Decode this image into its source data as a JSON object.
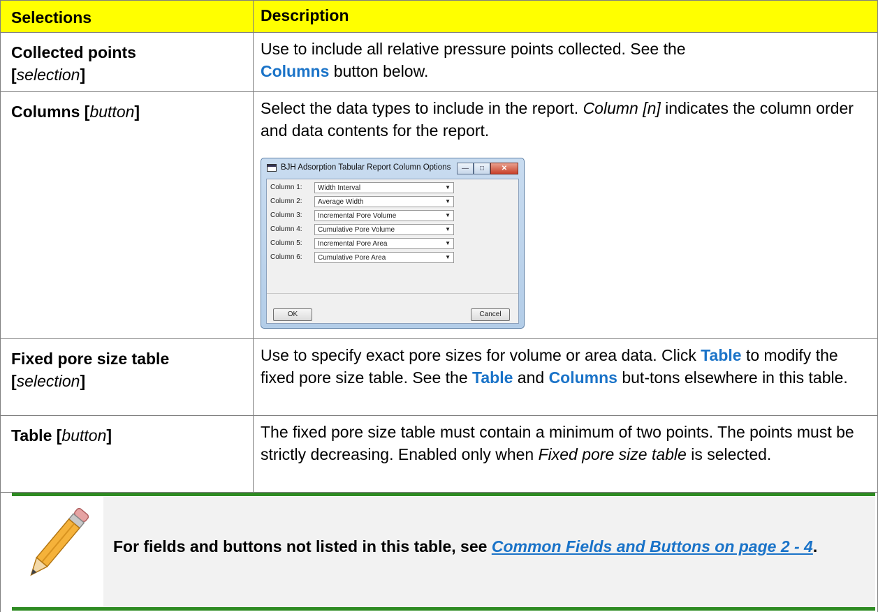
{
  "header": {
    "col1": "Selections",
    "col2": "Description"
  },
  "rows": [
    {
      "sel_name": "Collected points",
      "sel_bracket_open": "[",
      "sel_type": "selection",
      "sel_bracket_close": "]",
      "desc": {
        "p1": "Use to include all relative pressure points collected. See the",
        "link1": "Columns",
        "p2": " button below."
      }
    },
    {
      "sel_name": "Columns [",
      "sel_type": "button",
      "sel_bracket_close": "]",
      "desc": {
        "p1": "Select the data types to include in the report. ",
        "italic1": "Column [n]",
        "p2": " indicates the column order and data contents for the report."
      }
    },
    {
      "sel_name": "Fixed pore size table",
      "sel_bracket_open": "[",
      "sel_type": "selection",
      "sel_bracket_close": "]",
      "desc": {
        "p1": "Use to specify exact pore sizes for volume or area data. Click ",
        "link1": "Table",
        "p2": " to modify the fixed pore size table. See the ",
        "link2": "Table",
        "p3": " and ",
        "link3": "Columns",
        "p4": " but-tons elsewhere in this table."
      }
    },
    {
      "sel_name": "Table [",
      "sel_type": "button",
      "sel_bracket_close": "]",
      "desc": {
        "p1": "The fixed pore size table must contain a minimum of two points. The points must be strictly decreasing. Enabled only when ",
        "italic1": "Fixed pore size table",
        "p2": " is selected."
      }
    }
  ],
  "dialog": {
    "title": "BJH Adsorption Tabular Report Column Options",
    "columns": [
      {
        "label": "Column 1:",
        "value": "Width Interval"
      },
      {
        "label": "Column 2:",
        "value": "Average Width"
      },
      {
        "label": "Column 3:",
        "value": "Incremental Pore Volume"
      },
      {
        "label": "Column 4:",
        "value": "Cumulative Pore Volume"
      },
      {
        "label": "Column 5:",
        "value": "Incremental Pore Area"
      },
      {
        "label": "Column 6:",
        "value": "Cumulative Pore Area"
      }
    ],
    "ok": "OK",
    "cancel": "Cancel",
    "minimize": "—",
    "maximize": "□",
    "close": "✕"
  },
  "note": {
    "prefix": "For fields and buttons not listed in this table, see ",
    "link": "Common Fields and Buttons on page 2 - 4",
    "suffix": "."
  },
  "colors": {
    "header_bg": "#ffff00",
    "link": "#1a73c8",
    "note_rule": "#2e8b22"
  },
  "icons": {
    "note": "pencil-icon"
  }
}
